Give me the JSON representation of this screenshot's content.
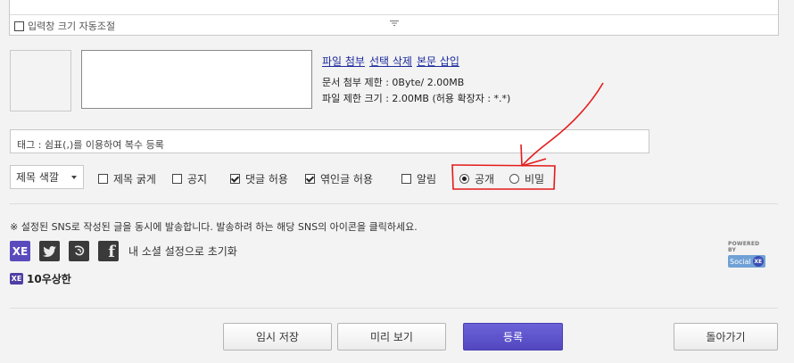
{
  "editor": {
    "autoresize_label": "입력창 크기 자동조절",
    "autoresize_checked": false
  },
  "attach": {
    "links": [
      "파일 첨부",
      "선택 삭제",
      "본문 삽입"
    ],
    "doc_limit": "문서 첨부 제한 : 0Byte/ 2.00MB",
    "file_limit": "파일 제한 크기 : 2.00MB (허용 확장자 : *.*)"
  },
  "tag": {
    "placeholder": "태그 : 쉼표(,)를 이용하여 복수 등록"
  },
  "options": {
    "title_color": "제목 색깔",
    "bold_title": {
      "label": "제목 굵게",
      "checked": false
    },
    "notice": {
      "label": "공지",
      "checked": false
    },
    "allow_comments": {
      "label": "댓글 허용",
      "checked": true
    },
    "allow_trackback": {
      "label": "엮인글 허용",
      "checked": true
    },
    "notify": {
      "label": "알림",
      "checked": false
    },
    "public": {
      "label": "공개",
      "selected": true
    },
    "secret": {
      "label": "비밀",
      "selected": false
    }
  },
  "sns": {
    "notice": "※ 설정된 SNS로 작성된 글을 동시에 발송합니다. 발송하려 하는 해당 SNS의 아이콘을 클릭하세요.",
    "icons": [
      {
        "name": "xe-icon",
        "glyph": "XE",
        "color": "#5a4bbd"
      },
      {
        "name": "twitter-icon",
        "glyph": "🐦",
        "color": "#3a3a3a"
      },
      {
        "name": "me2day-icon",
        "glyph": "☺",
        "color": "#3a3a3a"
      },
      {
        "name": "facebook-icon",
        "glyph": "f",
        "color": "#3a3a3a"
      }
    ],
    "reset_label": "내 소셜 설정으로 초기화",
    "powered_label": "POWERED BY",
    "powered_brand": "Social",
    "powered_xe": "XE",
    "user_badge": "XE",
    "username": "10우상한"
  },
  "buttons": {
    "temp_save": "임시 저장",
    "preview": "미리 보기",
    "submit": "등록",
    "back": "돌아가기"
  }
}
